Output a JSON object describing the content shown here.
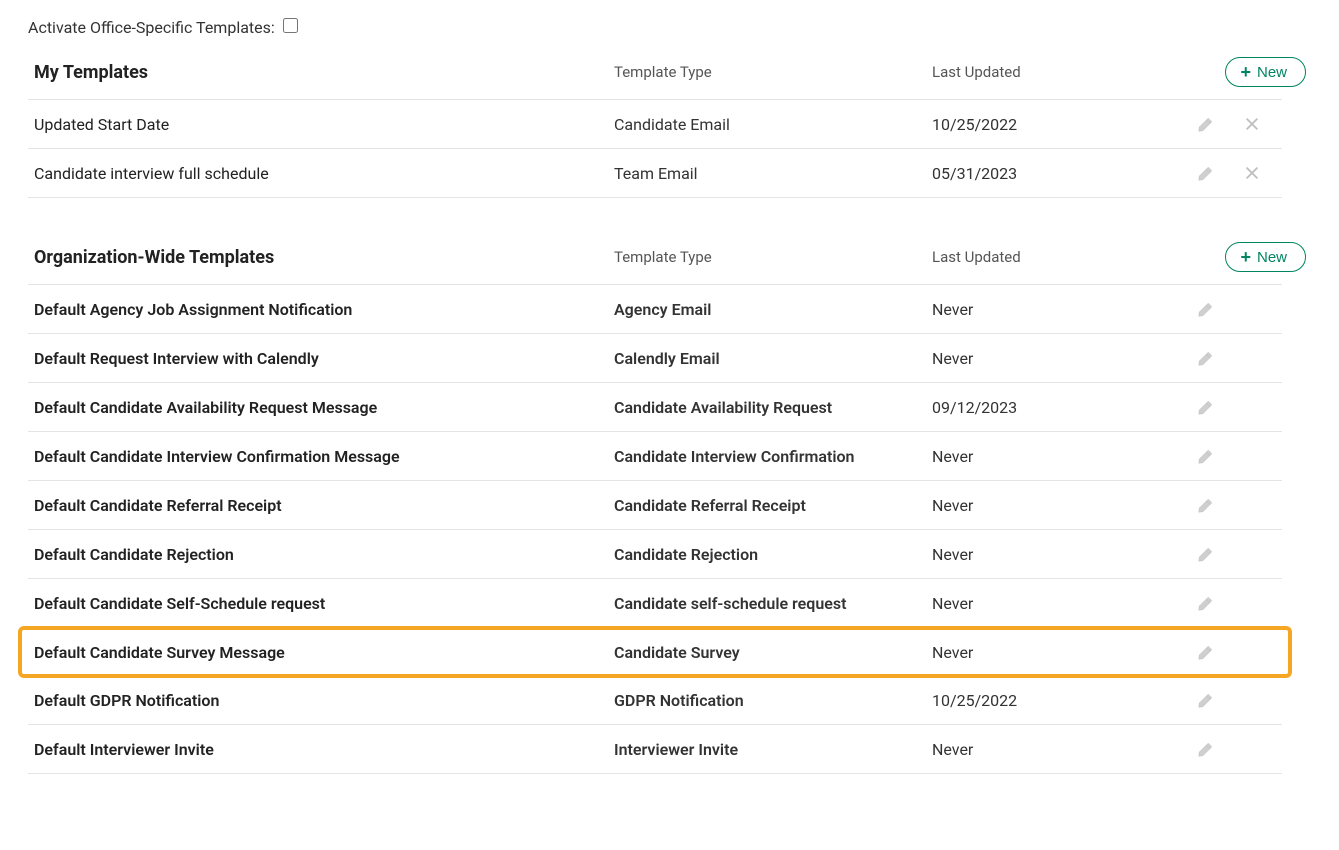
{
  "activate_label": "Activate Office-Specific Templates:",
  "columns": {
    "type": "Template Type",
    "updated": "Last Updated"
  },
  "buttons": {
    "new": "New"
  },
  "sections": {
    "my": {
      "title": "My Templates",
      "rows": [
        {
          "name": "Updated Start Date",
          "type": "Candidate Email",
          "updated": "10/25/2022",
          "deletable": true
        },
        {
          "name": "Candidate interview full schedule",
          "type": "Team Email",
          "updated": "05/31/2023",
          "deletable": true
        }
      ]
    },
    "org": {
      "title": "Organization-Wide Templates",
      "rows": [
        {
          "name": "Default Agency Job Assignment Notification",
          "type": "Agency Email",
          "updated": "Never"
        },
        {
          "name": "Default Request Interview with Calendly",
          "type": "Calendly Email",
          "updated": "Never"
        },
        {
          "name": "Default Candidate Availability Request Message",
          "type": "Candidate Availability Request",
          "updated": "09/12/2023"
        },
        {
          "name": "Default Candidate Interview Confirmation Message",
          "type": "Candidate Interview Confirmation",
          "updated": "Never"
        },
        {
          "name": "Default Candidate Referral Receipt",
          "type": "Candidate Referral Receipt",
          "updated": "Never"
        },
        {
          "name": "Default Candidate Rejection",
          "type": "Candidate Rejection",
          "updated": "Never"
        },
        {
          "name": "Default Candidate Self-Schedule request",
          "type": "Candidate self-schedule request",
          "updated": "Never"
        },
        {
          "name": "Default Candidate Survey Message",
          "type": "Candidate Survey",
          "updated": "Never",
          "highlight": true
        },
        {
          "name": "Default GDPR Notification",
          "type": "GDPR Notification",
          "updated": "10/25/2022"
        },
        {
          "name": "Default Interviewer Invite",
          "type": "Interviewer Invite",
          "updated": "Never"
        }
      ]
    }
  }
}
